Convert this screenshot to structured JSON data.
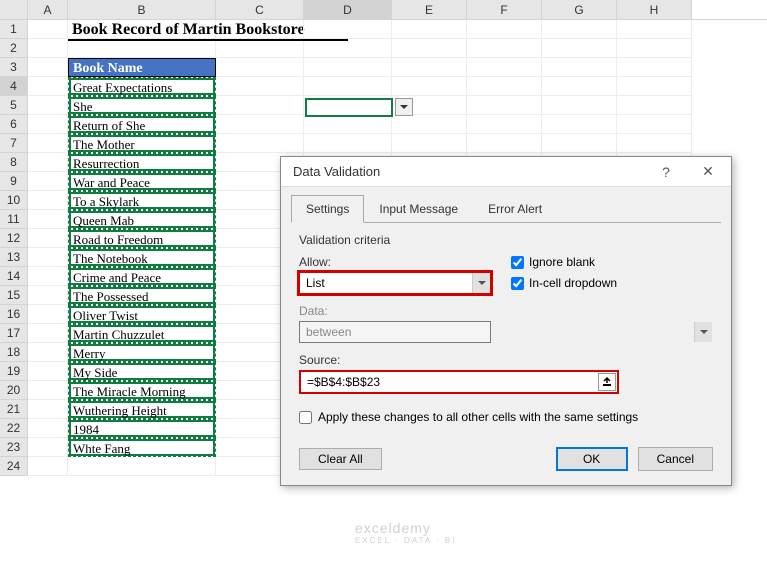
{
  "columns": [
    "A",
    "B",
    "C",
    "D",
    "E",
    "F",
    "G",
    "H"
  ],
  "rows": [
    "1",
    "2",
    "3",
    "4",
    "5",
    "6",
    "7",
    "8",
    "9",
    "10",
    "11",
    "12",
    "13",
    "14",
    "15",
    "16",
    "17",
    "18",
    "19",
    "20",
    "21",
    "22",
    "23",
    "24"
  ],
  "title": "Book Record of Martin Bookstore",
  "header": "Book Name",
  "books": [
    "Great Expectations",
    "She",
    "Return of She",
    "The Mother",
    "Resurrection",
    "War and Peace",
    "To a Skylark",
    "Queen Mab",
    "Road to Freedom",
    "The Notebook",
    "Crime and Peace",
    "The Possessed",
    "Oliver Twist",
    "Martin Chuzzulet",
    "Merry",
    "My Side",
    "The Miracle Morning",
    "Wuthering Height",
    "1984",
    "Whte Fang"
  ],
  "active_col": "D",
  "active_row": "4",
  "dialog": {
    "title": "Data Validation",
    "tabs": [
      "Settings",
      "Input Message",
      "Error Alert"
    ],
    "criteria_label": "Validation criteria",
    "allow_label": "Allow:",
    "allow_value": "List",
    "data_label": "Data:",
    "data_value": "between",
    "source_label": "Source:",
    "source_value": "=$B$4:$B$23",
    "ignore_blank": "Ignore blank",
    "incell_dropdown": "In-cell dropdown",
    "apply_text": "Apply these changes to all other cells with the same settings",
    "clear_all": "Clear All",
    "ok": "OK",
    "cancel": "Cancel"
  },
  "watermark": {
    "main": "exceldemy",
    "sub": "EXCEL · DATA · BI"
  }
}
